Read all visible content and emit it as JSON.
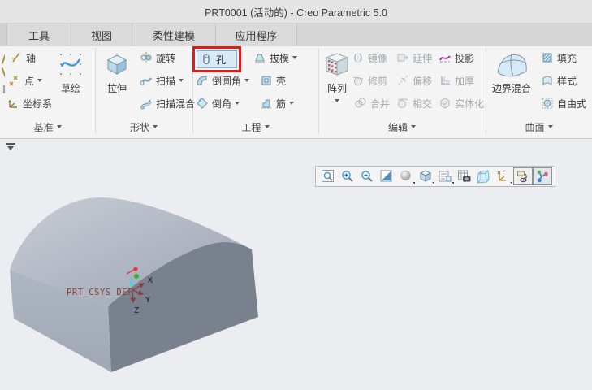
{
  "window": {
    "title": "PRT0001 (活动的) - Creo Parametric 5.0"
  },
  "tabs": {
    "tools": "工具",
    "view": "视图",
    "flexible_modeling": "柔性建模",
    "applications": "应用程序"
  },
  "ribbon": {
    "datum": {
      "group_label": "基准",
      "axis": "轴",
      "point": "点",
      "csys": "坐标系",
      "sketch": "草绘"
    },
    "shapes": {
      "group_label": "形状",
      "extrude": "拉伸",
      "revolve": "旋转",
      "sweep": "扫描",
      "swept_blend": "扫描混合"
    },
    "engineering": {
      "group_label": "工程",
      "hole": "孔",
      "draft": "拔模",
      "round": "倒圆角",
      "shell": "壳",
      "chamfer": "倒角",
      "rib": "筋"
    },
    "edit": {
      "group_label": "编辑",
      "pattern": "阵列",
      "mirror": "镜像",
      "trim": "修剪",
      "merge": "合并",
      "extend": "延伸",
      "offset": "偏移",
      "intersect": "相交",
      "project": "投影",
      "thicken": "加厚",
      "solidify": "实体化"
    },
    "surfaces": {
      "group_label": "曲面",
      "boundary_blend": "边界混合",
      "fill": "填充",
      "style": "样式",
      "freestyle": "自由式"
    }
  },
  "graphics_toolbar": {
    "icons": [
      "zoom-region",
      "zoom-in",
      "zoom-out",
      "refit",
      "shading-style",
      "display-style",
      "saved-views",
      "view-capture",
      "perspective-view",
      "datum-display-filters",
      "annotation-display",
      "spin-center"
    ],
    "pressed": [
      "annotation-display",
      "spin-center"
    ]
  },
  "model": {
    "csys_label": "PRT_CSYS_DEF",
    "axis_x": "X",
    "axis_y": "Y",
    "axis_z": "Z"
  },
  "colors": {
    "highlight_box": "#e11b1b",
    "hole_hover_bg": "#d8eaf8",
    "hole_hover_border": "#7fb0da",
    "model_front": "#a8b0bc",
    "model_right": "#79808e",
    "model_top_light": "#c8cdd5",
    "model_top_dark": "#9ba4b3",
    "csys_text": "#8a3c3c",
    "project_icon_accent": "#8b2fa0"
  }
}
